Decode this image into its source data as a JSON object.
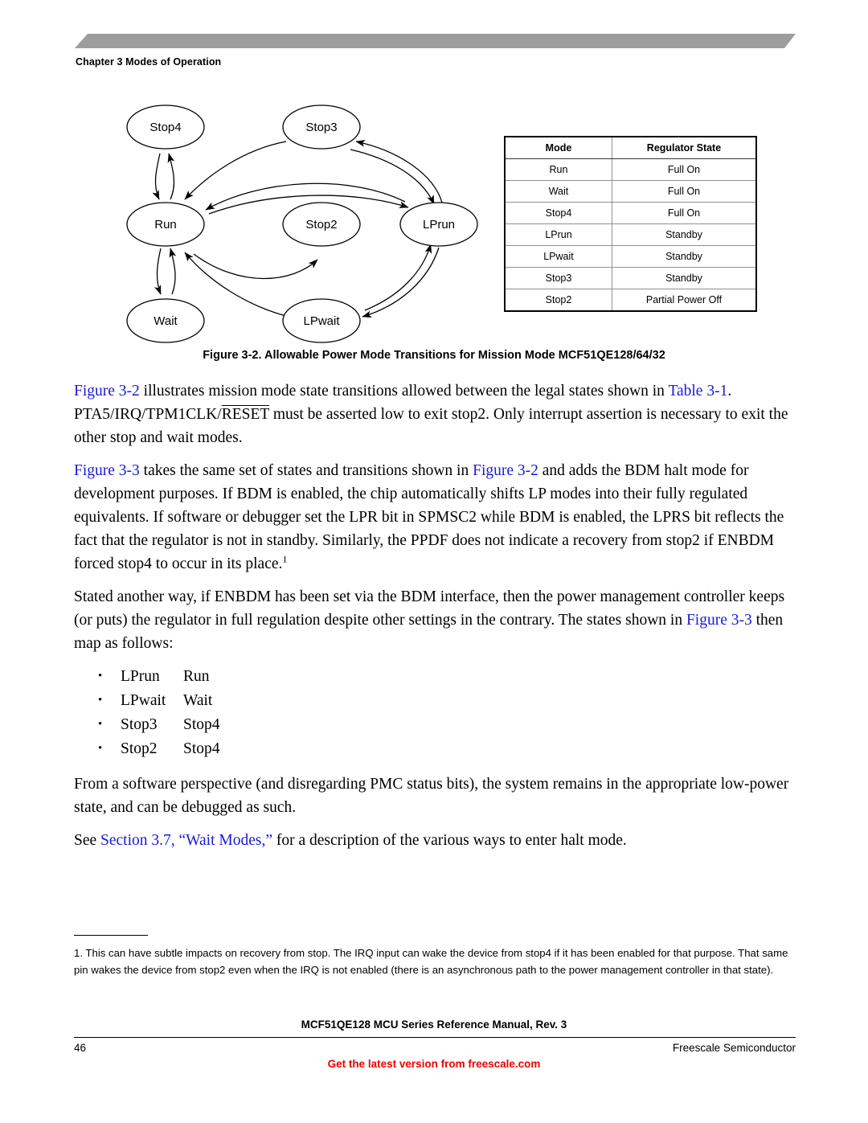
{
  "header": {
    "chapter_title": "Chapter 3 Modes of Operation",
    "banner_color": "#9d9d9d"
  },
  "figure": {
    "caption": "Figure 3-2. Allowable Power Mode Transitions for Mission Mode MCF51QE128/64/32",
    "diagram": {
      "type": "state-transition-diagram",
      "nodes": [
        {
          "id": "stop4",
          "label": "Stop4"
        },
        {
          "id": "stop3",
          "label": "Stop3"
        },
        {
          "id": "run",
          "label": "Run"
        },
        {
          "id": "stop2",
          "label": "Stop2"
        },
        {
          "id": "lprun",
          "label": "LPrun"
        },
        {
          "id": "wait",
          "label": "Wait"
        },
        {
          "id": "lpwait",
          "label": "LPwait"
        }
      ],
      "transitions": [
        {
          "from": "run",
          "to": "stop4",
          "bidirectional": true
        },
        {
          "from": "run",
          "to": "wait",
          "bidirectional": true
        },
        {
          "from": "run",
          "to": "stop3",
          "bidirectional": true
        },
        {
          "from": "run",
          "to": "lprun",
          "bidirectional": true
        },
        {
          "from": "run",
          "to": "stop2",
          "bidirectional": false
        },
        {
          "from": "stop3",
          "to": "lprun",
          "bidirectional": true
        },
        {
          "from": "lprun",
          "to": "lpwait",
          "bidirectional": true
        },
        {
          "from": "lpwait",
          "to": "run",
          "bidirectional": false
        }
      ]
    }
  },
  "table": {
    "headers": [
      "Mode",
      "Regulator State"
    ],
    "rows": [
      [
        "Run",
        "Full On"
      ],
      [
        "Wait",
        "Full On"
      ],
      [
        "Stop4",
        "Full On"
      ],
      [
        "LPrun",
        "Standby"
      ],
      [
        "LPwait",
        "Standby"
      ],
      [
        "Stop3",
        "Standby"
      ],
      [
        "Stop2",
        "Partial Power Off"
      ]
    ]
  },
  "body": {
    "para1": {
      "link1": "Figure 3-2",
      "t1": " illustrates mission mode state transitions allowed between the legal states shown in ",
      "link2": "Table 3-1",
      "t2": ". PTA5/IRQ/TPM1CLK/",
      "overline": "RESET",
      "t3": " must be asserted low to exit stop2. Only interrupt assertion is necessary to exit the other stop and wait modes."
    },
    "para2": {
      "link1": "Figure 3-3",
      "t1": " takes the same set of states and transitions shown in ",
      "link2": "Figure 3-2",
      "t2": " and adds the BDM halt mode for development purposes. If BDM is enabled, the chip automatically shifts LP modes into their fully regulated equivalents. If software or debugger set the LPR bit in SPMSC2 while BDM is enabled, the LPRS bit reflects the fact that the regulator is not in standby. Similarly, the PPDF does not indicate a recovery from stop2 if ENBDM forced stop4 to occur in its place.",
      "footnote_marker": "1"
    },
    "para3": {
      "t1": "Stated another way, if ENBDM has been set via the BDM interface, then the power management controller keeps (or puts) the regulator in full regulation despite other settings in the contrary. The states shown in ",
      "link1": "Figure 3-3",
      "t2": " then map as follows:"
    },
    "map_list": [
      {
        "from": "LPrun",
        "to": "Run"
      },
      {
        "from": "LPwait",
        "to": "Wait"
      },
      {
        "from": "Stop3",
        "to": "Stop4"
      },
      {
        "from": "Stop2",
        "to": "Stop4"
      }
    ],
    "para4": "From a software perspective (and disregarding PMC status bits), the system remains in the appropriate low-power state, and can be debugged as such.",
    "para5": {
      "t1": "See ",
      "link1": "Section 3.7, “Wait Modes,”",
      "t2": " for a description of the various ways to enter halt mode."
    }
  },
  "footnote": {
    "text": "1. This can have subtle impacts on recovery from stop. The IRQ input can wake the device from stop4 if it has been enabled for that purpose. That same pin wakes the device from stop2 even when the IRQ is not enabled (there is an asynchronous path to the power management controller in that state)."
  },
  "footer": {
    "manual_title": "MCF51QE128 MCU Series Reference Manual, Rev. 3",
    "page_number": "46",
    "company": "Freescale Semiconductor",
    "promo": "Get the latest version from freescale.com",
    "promo_color": "#ee0000"
  }
}
